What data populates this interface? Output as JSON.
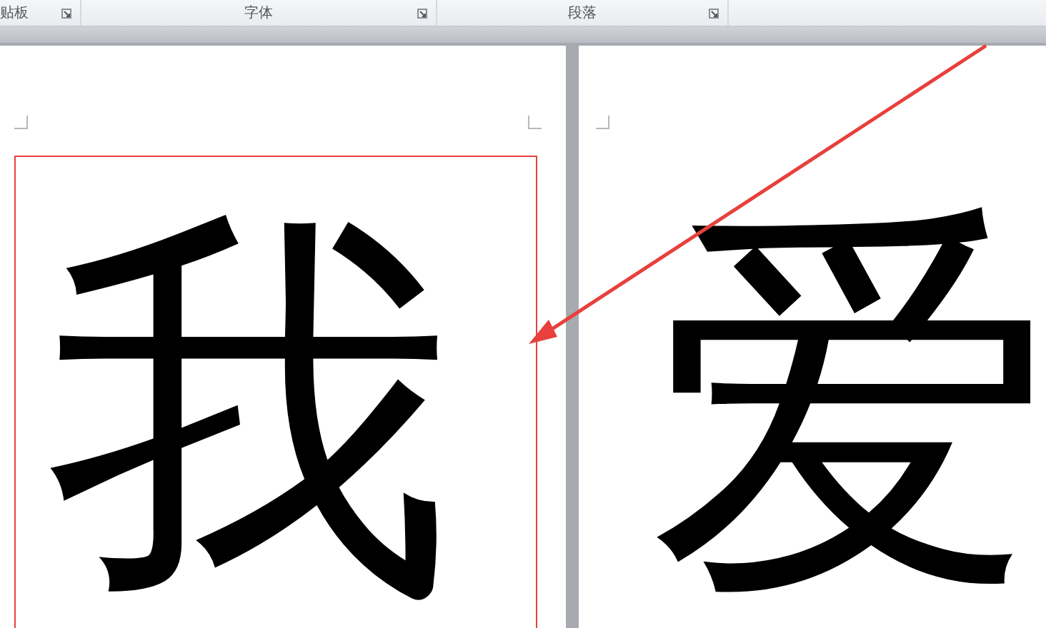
{
  "ribbon": {
    "groups": [
      {
        "label": "贴板"
      },
      {
        "label": "字体"
      },
      {
        "label": "段落"
      }
    ]
  },
  "pages": [
    {
      "character": "我",
      "framed": true
    },
    {
      "character": "爱",
      "framed": false
    }
  ],
  "annotation": {
    "kind": "arrow",
    "color": "#e8403c"
  }
}
